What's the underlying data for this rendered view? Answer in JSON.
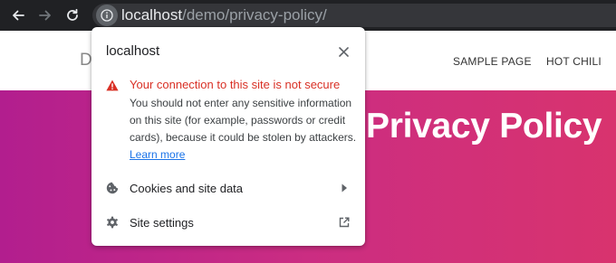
{
  "browser": {
    "url_host": "localhost",
    "url_path": "/demo/privacy-policy/",
    "icons": {
      "back": "back-arrow-icon",
      "forward": "forward-arrow-icon",
      "reload": "reload-icon",
      "site_info": "info-icon"
    }
  },
  "site": {
    "logo_fragment": "De",
    "nav": [
      {
        "label": "SAMPLE PAGE"
      },
      {
        "label": "HOT CHILI"
      }
    ],
    "hero_title": "Privacy Policy"
  },
  "popup": {
    "title": "localhost",
    "warning_title": "Your connection to this site is not secure",
    "warning_body": "You should not enter any sensitive information on this site (for example, passwords or credit cards), because it could be stolen by attackers.",
    "learn_more": "Learn more",
    "items": [
      {
        "label": "Cookies and site data",
        "icon": "cookie-icon",
        "trail": "chevron-right-icon"
      },
      {
        "label": "Site settings",
        "icon": "gear-icon",
        "trail": "external-link-icon"
      }
    ]
  },
  "colors": {
    "warning": "#d93025",
    "link": "#1a73e8",
    "hero_gradient_start": "#b21e8e",
    "hero_gradient_end": "#d8336e"
  }
}
